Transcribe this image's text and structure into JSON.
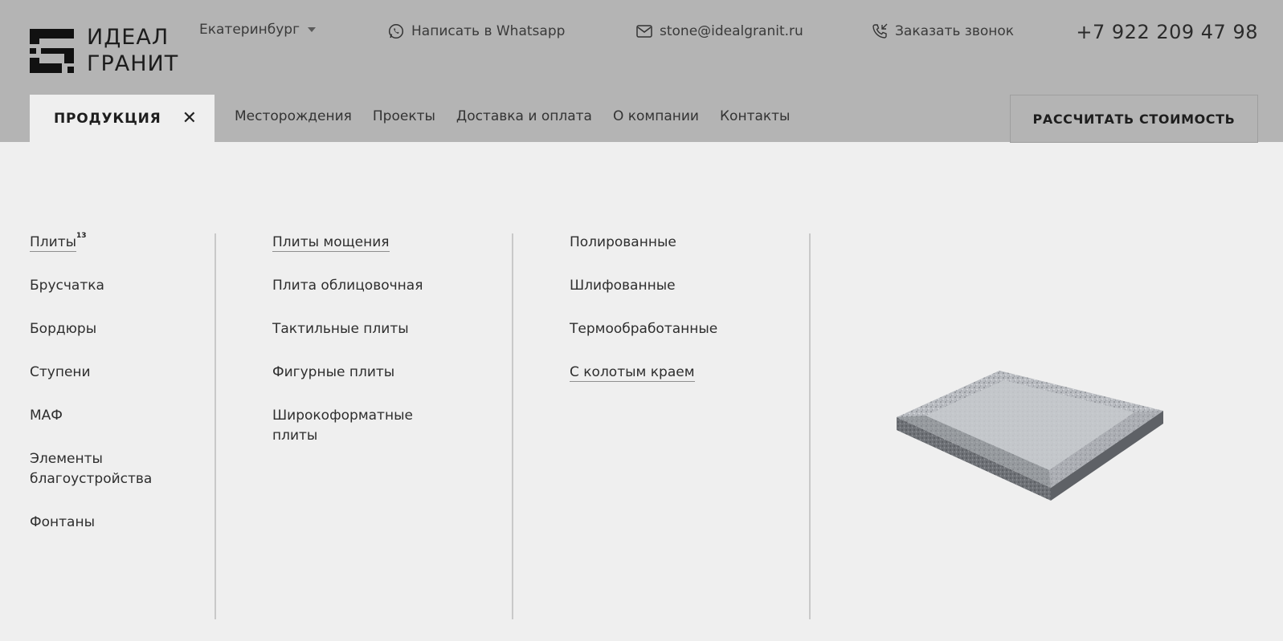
{
  "header": {
    "logo_line1": "ИДЕАЛ",
    "logo_line2": "ГРАНИТ",
    "city": "Екатеринбург",
    "whatsapp": "Написать в Whatsapp",
    "email": "stone@idealgranit.ru",
    "callback": "Заказать звонок",
    "phone": "+7 922 209 47 98"
  },
  "nav": {
    "active": "ПРОДУКЦИЯ",
    "links": [
      "Месторождения",
      "Проекты",
      "Доставка и оплата",
      "О компании",
      "Контакты"
    ],
    "calc_button": "РАССЧИТАТЬ СТОИМОСТЬ"
  },
  "menu": {
    "categories": [
      "Плиты",
      "Брусчатка",
      "Бордюры",
      "Ступени",
      "МАФ",
      "Элементы благоустройства",
      "Фонтаны"
    ],
    "categories_badge": "13",
    "subcategories": [
      "Плиты мощения",
      "Плита облицовочная",
      "Тактильные плиты",
      "Фигурные плиты",
      "Широкоформатные плиты"
    ],
    "finishes": [
      "Полированные",
      "Шлифованные",
      "Термообработанные",
      "С колотым краем"
    ]
  },
  "icons": [
    "logo-icon",
    "caret-down-icon",
    "whatsapp-icon",
    "mail-icon",
    "phone-call-icon",
    "close-icon"
  ],
  "colors": {
    "header_bg": "#b4b4b4",
    "menu_bg": "#efefef",
    "text": "#2b2b2b"
  }
}
